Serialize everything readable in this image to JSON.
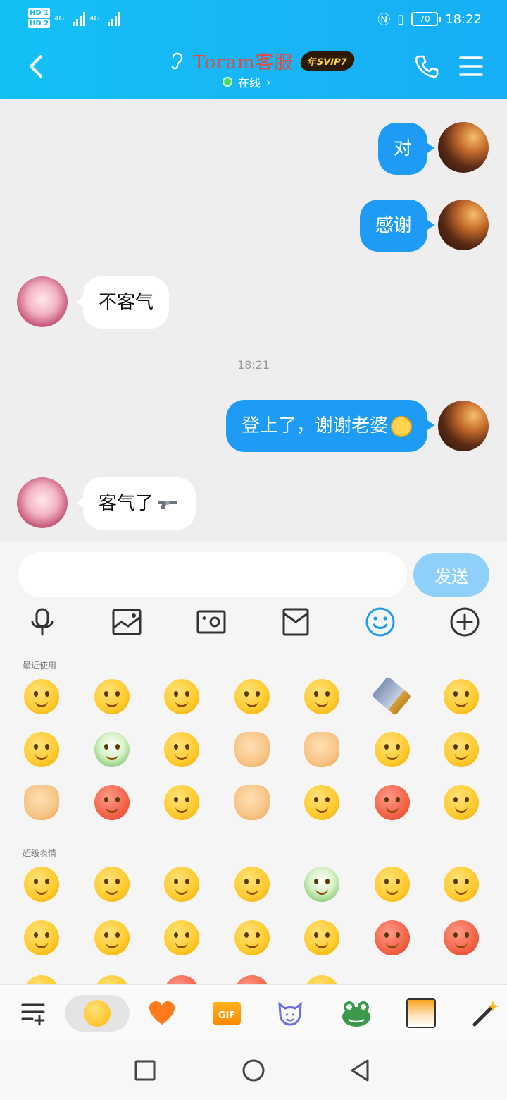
{
  "status_bar": {
    "hd1": "HD 1",
    "hd2": "HD 2",
    "net1": "4G",
    "net2": "4G",
    "battery": "70",
    "time": "18:22"
  },
  "header": {
    "title": "Toram客服",
    "badge": "年SVIP7",
    "presence": "在线",
    "presence_chevron": "›"
  },
  "messages": [
    {
      "side": "me",
      "text": "对"
    },
    {
      "side": "me",
      "text": "感谢"
    },
    {
      "side": "them",
      "text": "不客气"
    },
    {
      "type": "time",
      "text": "18:21"
    },
    {
      "side": "me",
      "text": "登上了，谢谢老婆",
      "emoji": "embarrassed-face-emoji"
    },
    {
      "side": "them",
      "text": "客气了",
      "emoji": "gun-emoji"
    }
  ],
  "input": {
    "value": "",
    "send_label": "发送"
  },
  "toolbar": [
    "microphone-icon",
    "image-icon",
    "camera-icon",
    "envelope-icon",
    "emoji-icon",
    "plus-icon"
  ],
  "emoji_panel": {
    "recent_label": "最近使用",
    "super_label": "超级表情",
    "recent": [
      [
        "embarrassed-chick",
        "smile",
        "facepalm",
        "thinking",
        "laugh-cry",
        "kitchen-knife",
        "blush"
      ],
      [
        "sly-grin",
        "cabbage-dog",
        "nosebleed",
        "thumbs-up",
        "ok-hand",
        "smirk",
        "lollipop"
      ],
      [
        "handshake",
        "angry",
        "sad",
        "thumb",
        "shy",
        "sweat",
        "sleepy"
      ]
    ],
    "super": [
      [
        "crying",
        "rolling-laugh",
        "blush",
        "cool",
        "cabbage-dog",
        "heart-eyes",
        "heart-hands"
      ],
      [
        "party",
        "lollipop",
        "shock",
        "dizzy",
        "peach-hands",
        "heart-pillow",
        "pleading"
      ]
    ]
  },
  "emoji_tabs": [
    "list-add-icon",
    "emoji-tab",
    "heart-tab",
    "gif-tab",
    "cat-tab",
    "frog-tab",
    "comic-tab",
    "magic-wand-tab"
  ],
  "gif_label": "GIF",
  "colors": {
    "header": "#16b8f6",
    "bubble_me": "#1e9cf5",
    "send": "#8ed0fa",
    "title": "#e9473b"
  }
}
